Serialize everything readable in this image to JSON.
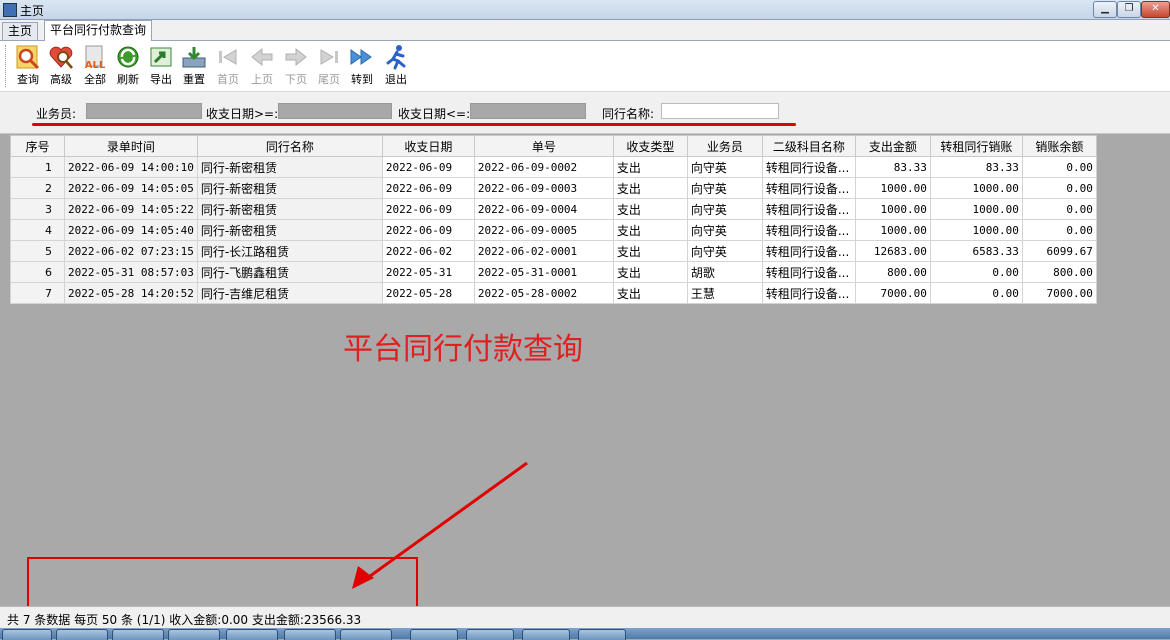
{
  "window": {
    "title": "主页"
  },
  "tabs": [
    {
      "label": "主页"
    },
    {
      "label": "平台同行付款查询"
    }
  ],
  "toolbar": {
    "buttons": [
      {
        "label": "查询",
        "icon": "magnifier-icon"
      },
      {
        "label": "高级",
        "icon": "heart-magnifier-icon"
      },
      {
        "label": "全部",
        "icon": "all-icon"
      },
      {
        "label": "刷新",
        "icon": "refresh-icon"
      },
      {
        "label": "导出",
        "icon": "export-icon"
      },
      {
        "label": "重置",
        "icon": "reset-icon"
      },
      {
        "label": "首页",
        "icon": "first-page-icon"
      },
      {
        "label": "上页",
        "icon": "previous-page-icon"
      },
      {
        "label": "下页",
        "icon": "next-page-icon"
      },
      {
        "label": "尾页",
        "icon": "last-page-icon"
      },
      {
        "label": "转到",
        "icon": "goto-icon"
      },
      {
        "label": "退出",
        "icon": "exit-runner-icon"
      }
    ]
  },
  "filters": {
    "salesperson_label": "业务员:",
    "date_from_label": "收支日期>=:",
    "date_to_label": "收支日期<=:",
    "peer_name_label": "同行名称:",
    "peer_name_value": ""
  },
  "grid": {
    "columns": [
      "序号",
      "录单时间",
      "同行名称",
      "收支日期",
      "单号",
      "收支类型",
      "业务员",
      "二级科目名称",
      "支出金额",
      "转租同行销账",
      "销账余额"
    ],
    "rows": [
      [
        "1",
        "2022-06-09 14:00:10",
        "同行-新密租赁",
        "2022-06-09",
        "2022-06-09-0002",
        "支出",
        "向守英",
        "转租同行设备...",
        "83.33",
        "83.33",
        "0.00"
      ],
      [
        "2",
        "2022-06-09 14:05:05",
        "同行-新密租赁",
        "2022-06-09",
        "2022-06-09-0003",
        "支出",
        "向守英",
        "转租同行设备...",
        "1000.00",
        "1000.00",
        "0.00"
      ],
      [
        "3",
        "2022-06-09 14:05:22",
        "同行-新密租赁",
        "2022-06-09",
        "2022-06-09-0004",
        "支出",
        "向守英",
        "转租同行设备...",
        "1000.00",
        "1000.00",
        "0.00"
      ],
      [
        "4",
        "2022-06-09 14:05:40",
        "同行-新密租赁",
        "2022-06-09",
        "2022-06-09-0005",
        "支出",
        "向守英",
        "转租同行设备...",
        "1000.00",
        "1000.00",
        "0.00"
      ],
      [
        "5",
        "2022-06-02 07:23:15",
        "同行-长江路租赁",
        "2022-06-02",
        "2022-06-02-0001",
        "支出",
        "向守英",
        "转租同行设备...",
        "12683.00",
        "6583.33",
        "6099.67"
      ],
      [
        "6",
        "2022-05-31 08:57:03",
        "同行-飞鹏鑫租赁",
        "2022-05-31",
        "2022-05-31-0001",
        "支出",
        "胡歌",
        "转租同行设备...",
        "800.00",
        "0.00",
        "800.00"
      ],
      [
        "7",
        "2022-05-28 14:20:52",
        "同行-吉维尼租赁",
        "2022-05-28",
        "2022-05-28-0002",
        "支出",
        "王慧",
        "转租同行设备...",
        "7000.00",
        "0.00",
        "7000.00"
      ]
    ]
  },
  "annotation": {
    "caption": "平台同行付款查询"
  },
  "status": {
    "text": "共 7 条数据  每页 50 条 (1/1)  收入金额:0.00  支出金额:23566.33"
  },
  "colors": {
    "accent_red": "#e00000",
    "background_gray": "#a9a9a9"
  }
}
